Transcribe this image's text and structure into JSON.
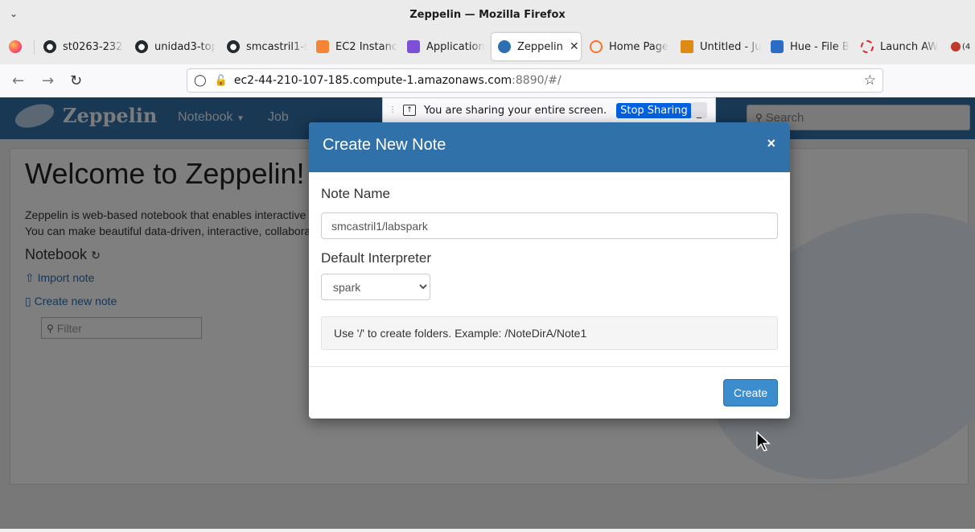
{
  "window": {
    "title": "Zeppelin — Mozilla Firefox"
  },
  "tabs": [
    {
      "label": "st0263-232/",
      "icon": "github-icon"
    },
    {
      "label": "unidad3-top",
      "icon": "github-icon"
    },
    {
      "label": "smcastril1-s",
      "icon": "github-icon"
    },
    {
      "label": "EC2 Instanc",
      "icon": "aws-ec2-icon"
    },
    {
      "label": "Application",
      "icon": "application-icon"
    },
    {
      "label": "Zeppelin",
      "icon": "zeppelin-icon",
      "active": true
    },
    {
      "label": "Home Page",
      "icon": "jupyter-icon"
    },
    {
      "label": "Untitled - Ju",
      "icon": "notebook-icon"
    },
    {
      "label": "Hue - File B",
      "icon": "hue-icon"
    },
    {
      "label": "Launch AW",
      "icon": "aws-launch-icon"
    },
    {
      "label": "(4",
      "icon": "audio-icon"
    }
  ],
  "navbar": {
    "url_host": "ec2-44-210-107-185.compute-1.amazonaws.com",
    "url_rest": ":8890/#/"
  },
  "sharing": {
    "message": "You are sharing your entire screen.",
    "stop_label": "Stop Sharing",
    "minimize_label": "_"
  },
  "zeppelin": {
    "brand": "Zeppelin",
    "menu_notebook": "Notebook",
    "menu_job": "Job",
    "search_placeholder": "Search",
    "welcome": "Welcome to Zeppelin!",
    "intro_line1": "Zeppelin is web-based notebook that enables interactive d",
    "intro_line2": "You can make beautiful data-driven, interactive, collabora",
    "notebook_heading": "Notebook",
    "import_note": "Import note",
    "create_new_note": "Create new note",
    "filter_placeholder": "Filter"
  },
  "modal": {
    "title": "Create New Note",
    "close_label": "×",
    "note_name_label": "Note Name",
    "note_name_value": "smcastril1/labspark",
    "interpreter_label": "Default Interpreter",
    "interpreter_selected": "spark",
    "hint": "Use '/' to create folders. Example: /NoteDirA/Note1",
    "create_label": "Create"
  },
  "colors": {
    "zeppelin_blue": "#3071a9",
    "create_button": "#3c8dce",
    "stop_sharing": "#0061e0"
  }
}
